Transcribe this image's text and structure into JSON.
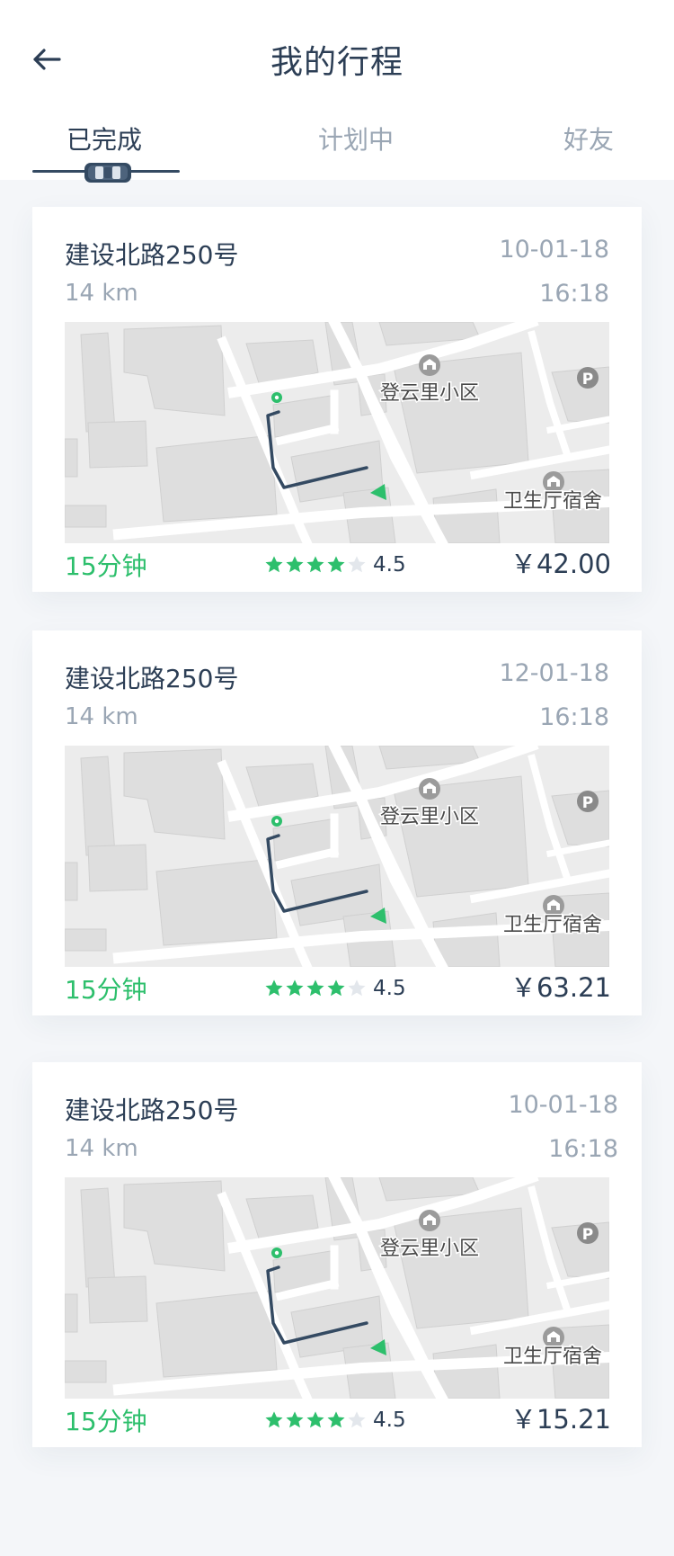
{
  "header": {
    "title": "我的行程",
    "tabs": [
      {
        "label": "已完成",
        "active": true
      },
      {
        "label": "计划中",
        "active": false
      },
      {
        "label": "好友",
        "active": false
      }
    ]
  },
  "map": {
    "poi_residential": "登云里小区",
    "poi_dormitory": "卫生厅宿舍",
    "parking_symbol": "P"
  },
  "trips": [
    {
      "address": "建设北路250号",
      "date": "10-01-18",
      "distance": "14 km",
      "time": "16:18",
      "duration": "15分钟",
      "rating": "4.5",
      "rating_value": 4.5,
      "price": "￥42.00"
    },
    {
      "address": "建设北路250号",
      "date": "12-01-18",
      "distance": "14 km",
      "time": "16:18",
      "duration": "15分钟",
      "rating": "4.5",
      "rating_value": 4.5,
      "price": "￥63.21"
    },
    {
      "address": "建设北路250号",
      "date": "10-01-18",
      "distance": "14 km",
      "time": "16:18",
      "duration": "15分钟",
      "rating": "4.5",
      "rating_value": 4.5,
      "price": "￥15.21"
    }
  ],
  "colors": {
    "accent_green": "#2dbf6c",
    "text_dark": "#2c3e55",
    "text_muted": "#9aa6b4",
    "route": "#344a62",
    "star_empty": "#e3e7ec"
  }
}
